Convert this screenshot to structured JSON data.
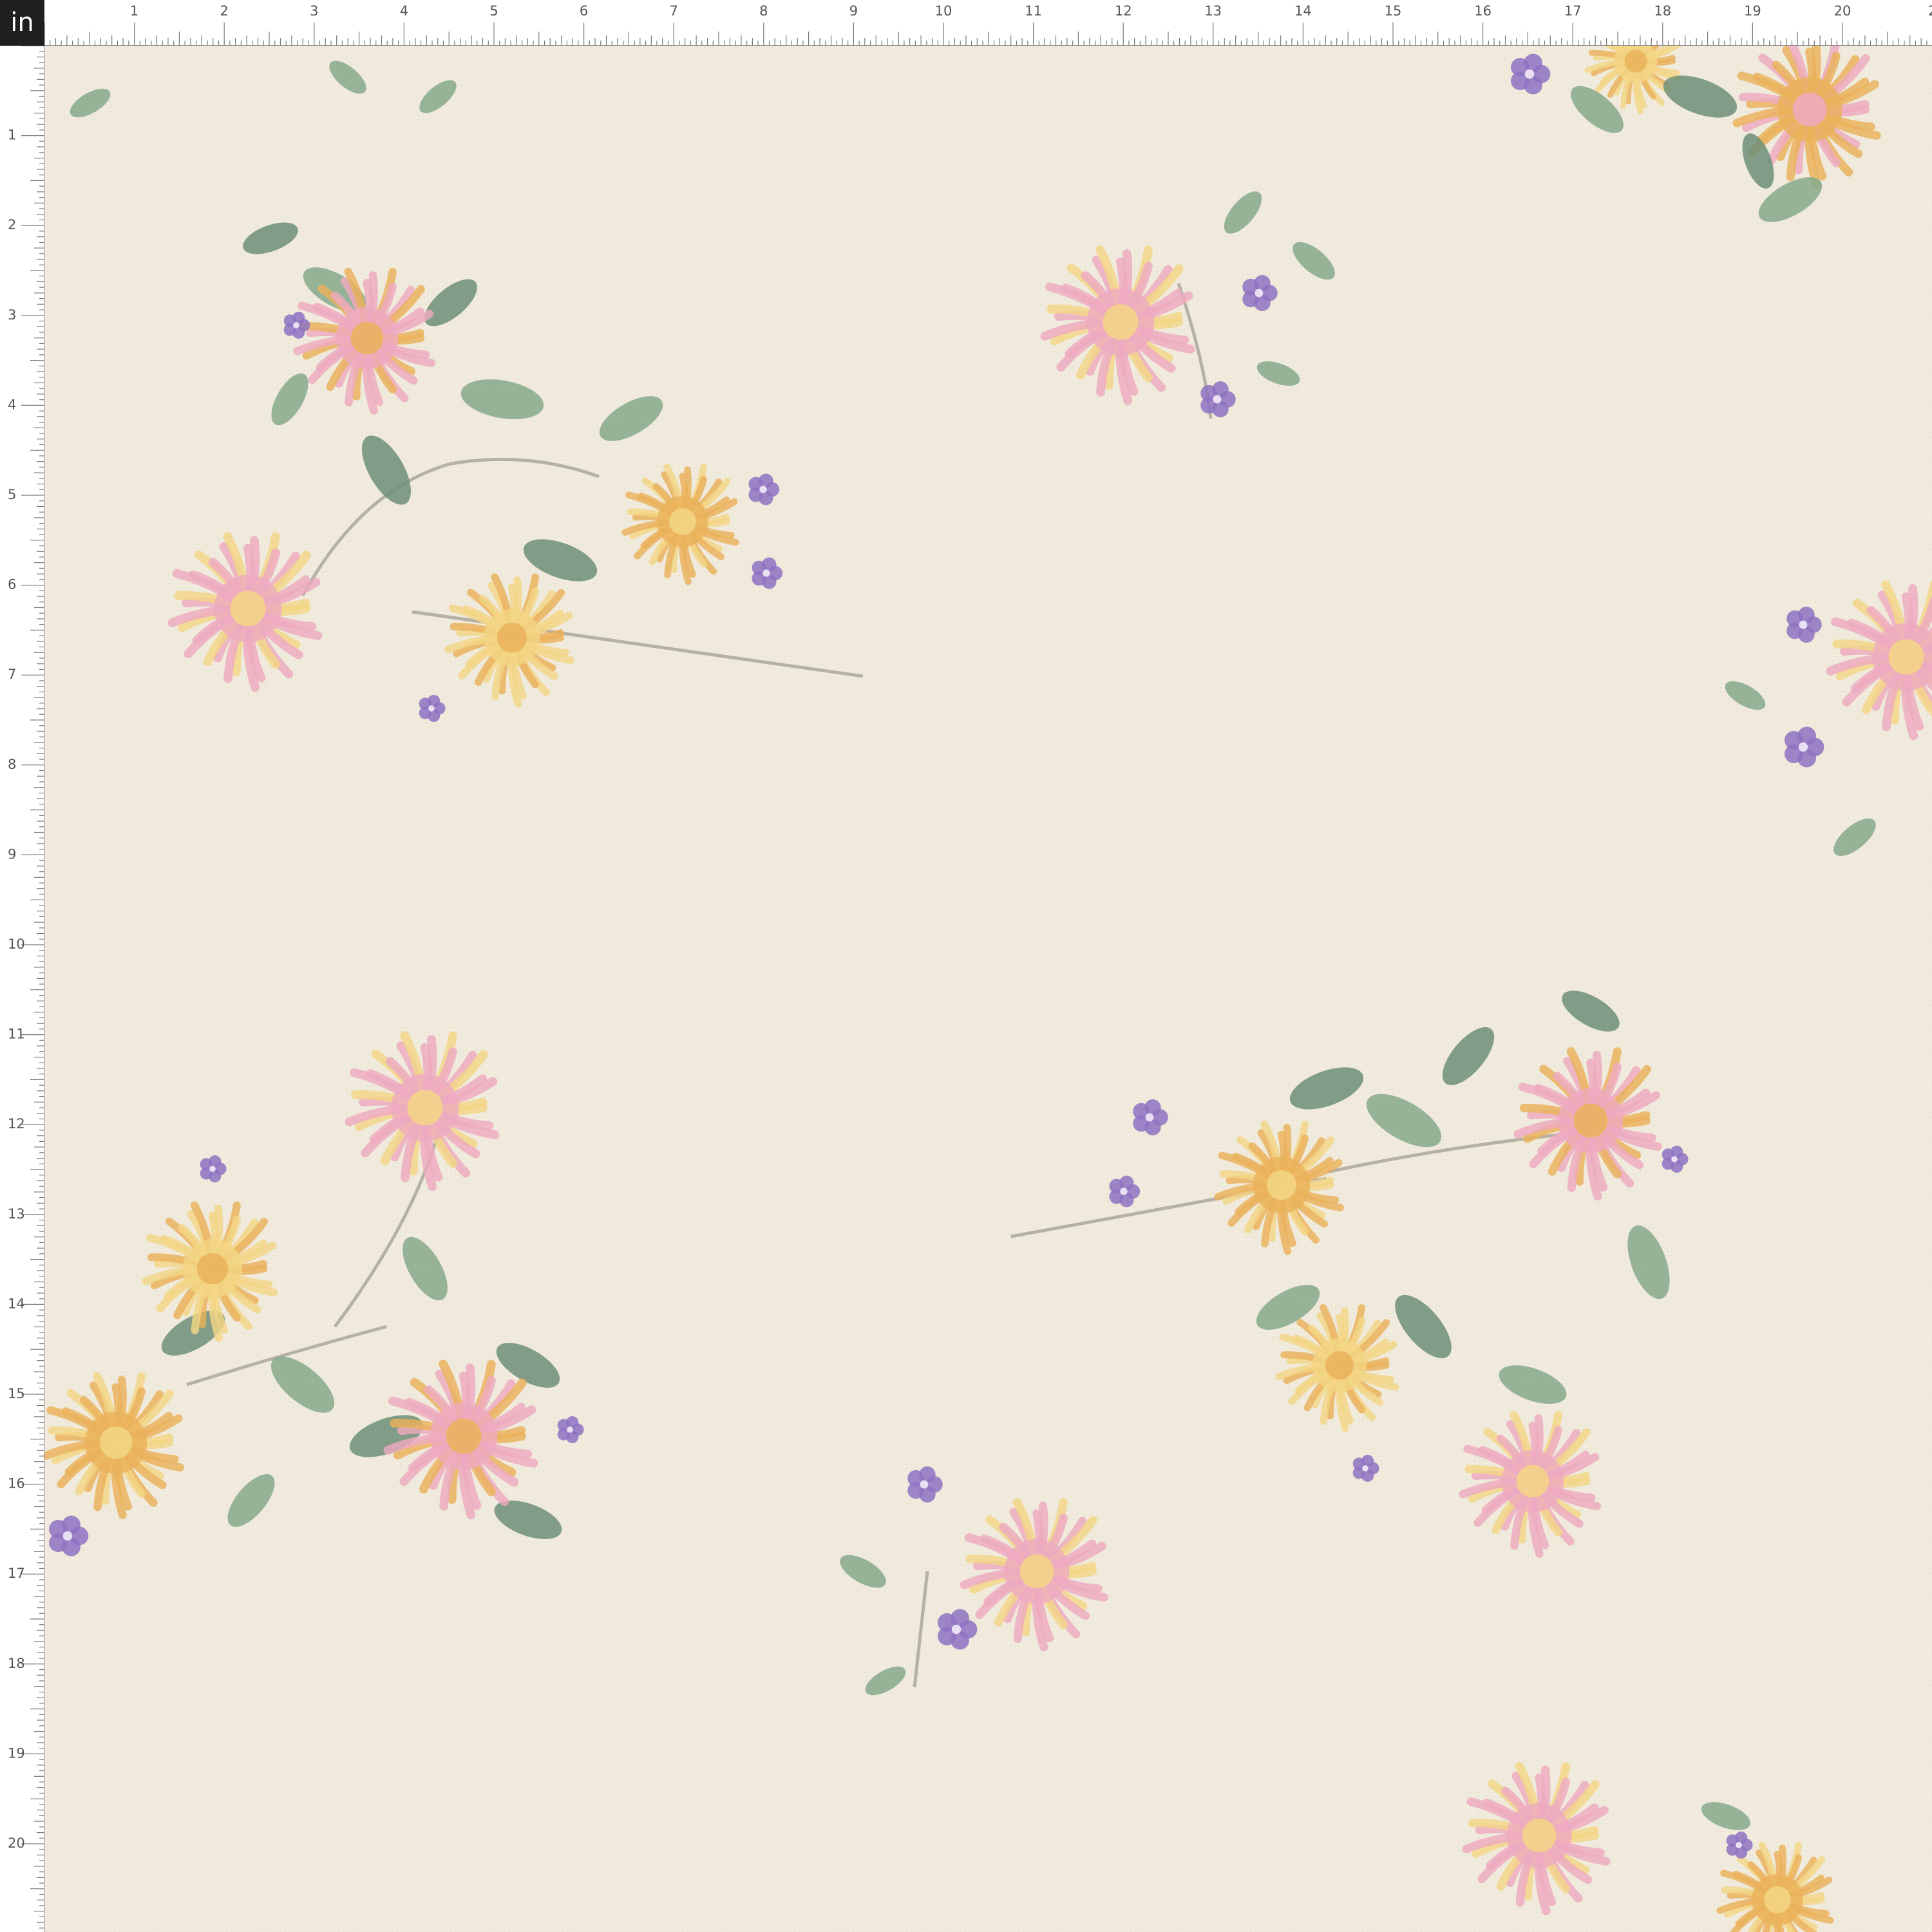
{
  "viewer": {
    "unit": "in",
    "top_ruler_labels": [
      "1",
      "2",
      "3",
      "4",
      "5",
      "6",
      "7",
      "8",
      "9",
      "10",
      "11",
      "12",
      "13",
      "14",
      "15",
      "16",
      "17",
      "18",
      "19",
      "20",
      "2"
    ],
    "left_ruler_labels": [
      "1",
      "2",
      "3",
      "4",
      "5",
      "6",
      "7",
      "8",
      "9",
      "10",
      "11",
      "12",
      "13",
      "14",
      "15",
      "16",
      "17",
      "18",
      "19",
      "20"
    ]
  },
  "fabric": {
    "description_icon": "floral-chrysanthemum-pattern",
    "colors": {
      "background": "#efeadb",
      "pink": "#eeaac0",
      "orange": "#eab15a",
      "yellow": "#f3d685",
      "leaf": "#86a98c",
      "leaf_dark": "#6f8f78",
      "violet": "#8e72c2",
      "stem": "#a7a29a"
    }
  }
}
